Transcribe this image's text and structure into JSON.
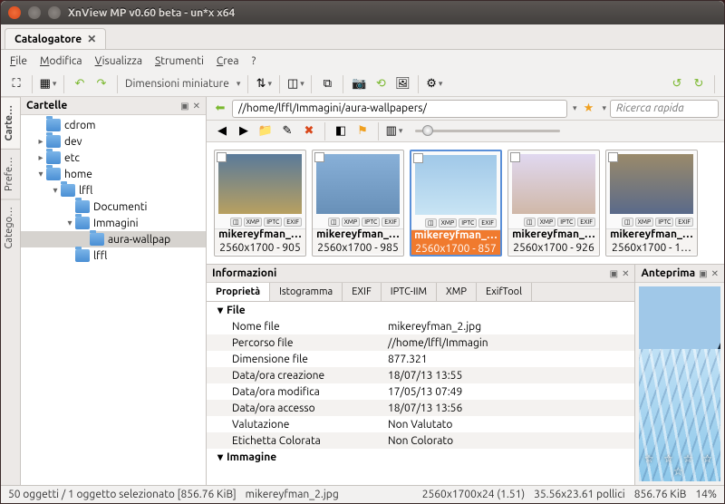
{
  "window": {
    "title": "XnView MP v0.60 beta - un*x x64"
  },
  "tab": {
    "label": "Catalogatore"
  },
  "menu": {
    "file": "File",
    "modifica": "Modifica",
    "visualizza": "Visualizza",
    "strumenti": "Strumenti",
    "crea": "Crea",
    "help": "?"
  },
  "toolbar": {
    "dim_label": "Dimensioni miniature"
  },
  "sidetabs": {
    "cartelle": "Carte…",
    "preferiti": "Prefe…",
    "categorie": "Catego…"
  },
  "folders": {
    "title": "Cartelle",
    "items": [
      {
        "name": "cdrom",
        "indent": 1,
        "twisty": ""
      },
      {
        "name": "dev",
        "indent": 1,
        "twisty": "▸"
      },
      {
        "name": "etc",
        "indent": 1,
        "twisty": "▸"
      },
      {
        "name": "home",
        "indent": 1,
        "twisty": "▾"
      },
      {
        "name": "lffl",
        "indent": 2,
        "twisty": "▾"
      },
      {
        "name": "Documenti",
        "indent": 3,
        "twisty": ""
      },
      {
        "name": "Immagini",
        "indent": 3,
        "twisty": "▾"
      },
      {
        "name": "aura-wallpap",
        "indent": 4,
        "twisty": "",
        "sel": true
      },
      {
        "name": "lffl",
        "indent": 3,
        "twisty": ""
      }
    ]
  },
  "address": {
    "path": "//home/lffl/Immagini/aura-wallpapers/",
    "search_placeholder": "Ricerca rapida"
  },
  "thumbs": [
    {
      "name": "mikereyfman_…",
      "dim": "2560x1700 - 905"
    },
    {
      "name": "mikereyfman_…",
      "dim": "2560x1700 - 985"
    },
    {
      "name": "mikereyfman_…",
      "dim": "2560x1700 - 857",
      "sel": true
    },
    {
      "name": "mikereyfman_…",
      "dim": "2560x1700 - 926"
    },
    {
      "name": "mikereyfman_…",
      "dim": "2560x1700 - 1…"
    }
  ],
  "info": {
    "title": "Informazioni",
    "tabs": {
      "proprieta": "Proprietà",
      "istogramma": "Istogramma",
      "exif": "EXIF",
      "iptc": "IPTC-IIM",
      "xmp": "XMP",
      "exiftool": "ExifTool"
    },
    "group_file": "File",
    "group_image": "Immagine",
    "rows": [
      {
        "k": "Nome file",
        "v": "mikereyfman_2.jpg"
      },
      {
        "k": "Percorso file",
        "v": "//home/lffl/Immagin"
      },
      {
        "k": "Dimensione file",
        "v": "877.321"
      },
      {
        "k": "Data/ora creazione",
        "v": "18/07/13 13:55"
      },
      {
        "k": "Data/ora modifica",
        "v": "17/05/13 07:49"
      },
      {
        "k": "Data/ora accesso",
        "v": "18/07/13 13:56"
      },
      {
        "k": "Valutazione",
        "v": "Non Valutato"
      },
      {
        "k": "Etichetta Colorata",
        "v": "Non Colorato"
      }
    ]
  },
  "preview": {
    "title": "Anteprima"
  },
  "status": {
    "left": "50 oggetti / 1 oggetto selezionato [856.76 KiB]",
    "file": "mikereyfman_2.jpg",
    "dims": "2560x1700x24 (1.51)",
    "inches": "35.56x23.61 pollici",
    "size": "856.76 KiB",
    "zoom": "14%"
  }
}
